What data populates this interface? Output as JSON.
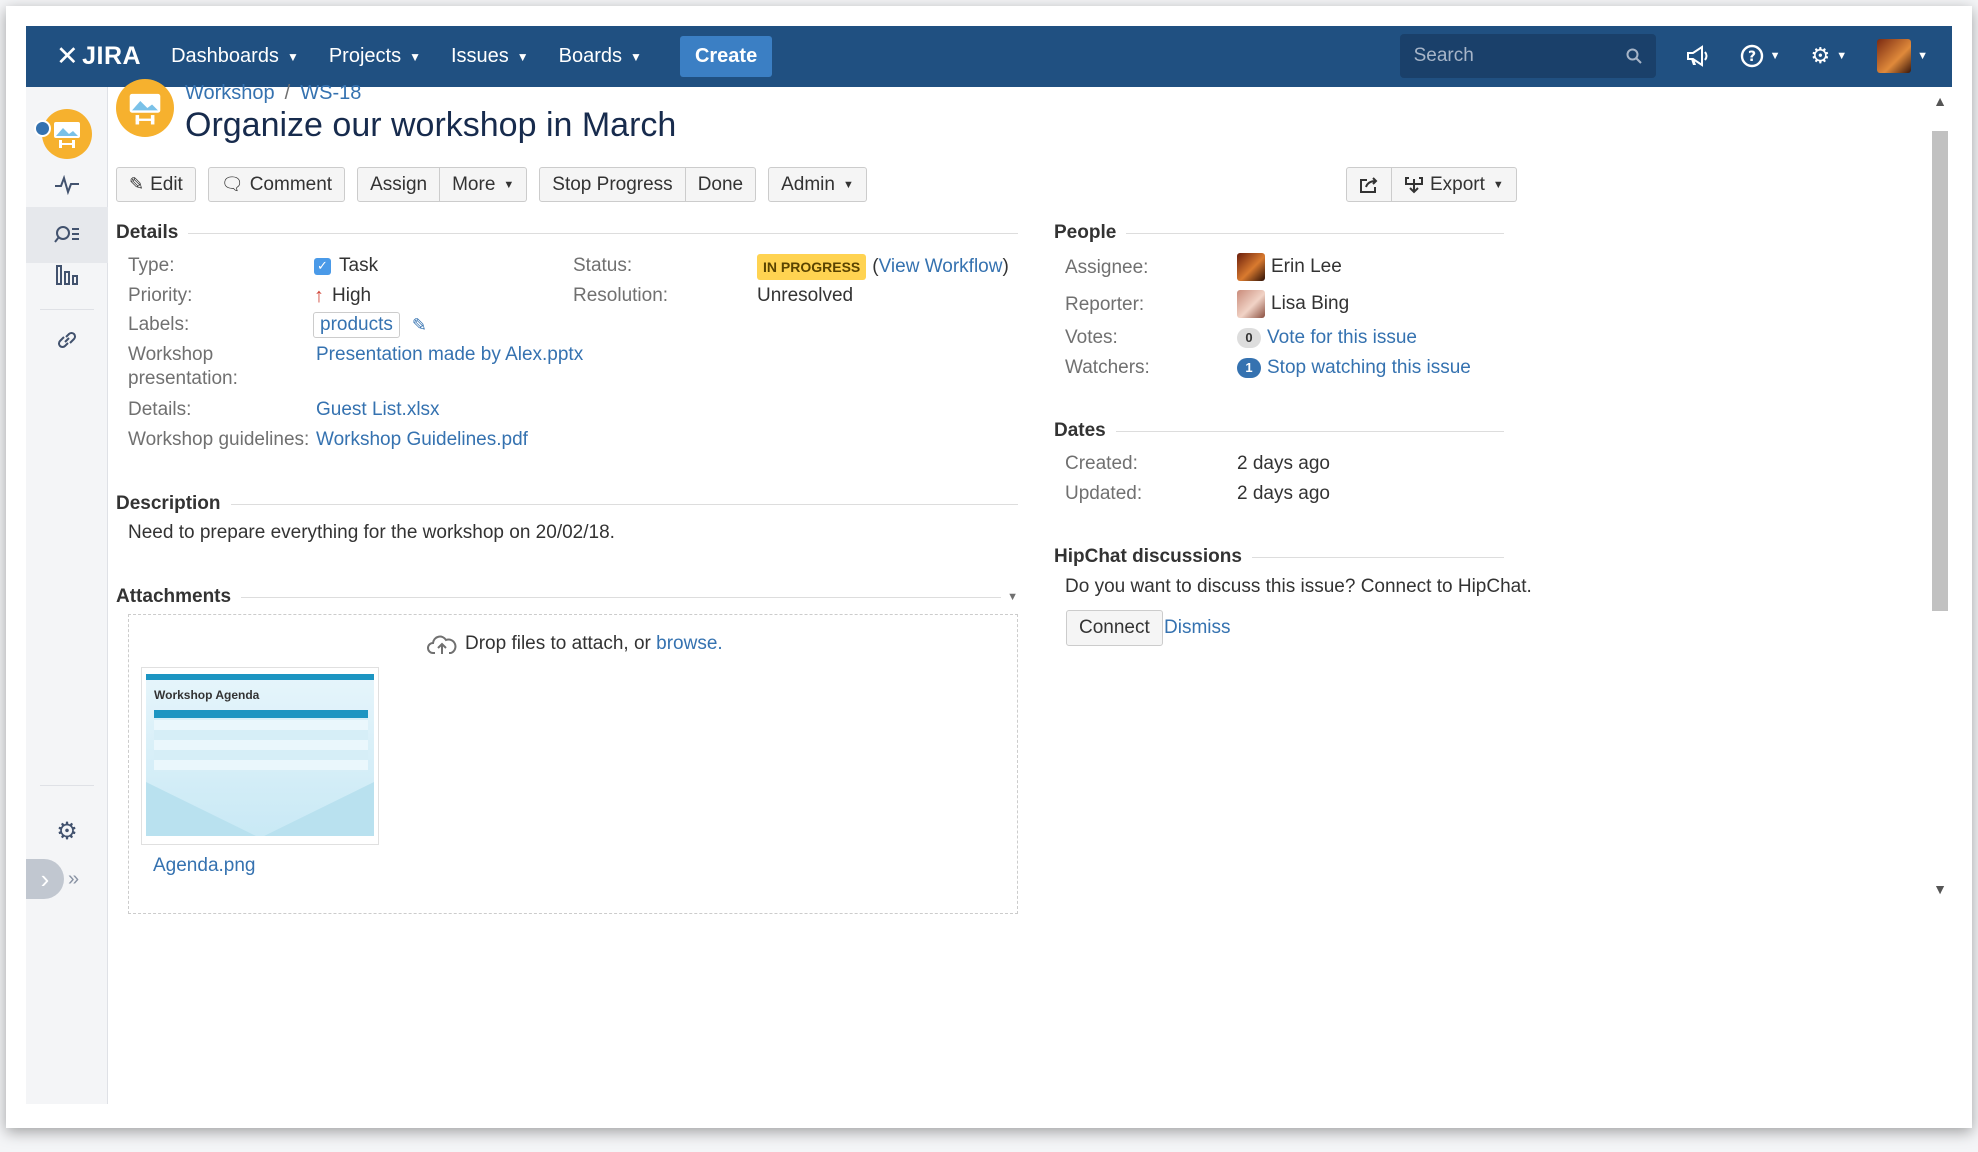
{
  "nav": {
    "logo": "JIRA",
    "items": [
      "Dashboards",
      "Projects",
      "Issues",
      "Boards"
    ],
    "create_label": "Create",
    "search_placeholder": "Search"
  },
  "breadcrumb": {
    "project": "Workshop",
    "issue_key": "WS-18"
  },
  "issue": {
    "title": "Organize our workshop in March"
  },
  "toolbar": {
    "edit": "Edit",
    "comment": "Comment",
    "assign": "Assign",
    "more": "More",
    "stop_progress": "Stop Progress",
    "done": "Done",
    "admin": "Admin",
    "export": "Export"
  },
  "details": {
    "heading": "Details",
    "type_label": "Type:",
    "type_value": "Task",
    "priority_label": "Priority:",
    "priority_value": "High",
    "labels_label": "Labels:",
    "labels_value": "products",
    "workshop_presentation_label_1": "Workshop",
    "workshop_presentation_label_2": "presentation:",
    "workshop_presentation_value": "Presentation made by Alex.pptx",
    "details_label": "Details:",
    "details_value": "Guest List.xlsx",
    "guidelines_label": "Workshop guidelines:",
    "guidelines_value": "Workshop Guidelines.pdf",
    "status_label": "Status:",
    "status_value": "IN PROGRESS",
    "view_workflow": "View Workflow",
    "resolution_label": "Resolution:",
    "resolution_value": "Unresolved"
  },
  "description": {
    "heading": "Description",
    "text": "Need to prepare everything for the workshop on 20/02/18."
  },
  "attachments": {
    "heading": "Attachments",
    "drop_text": "Drop files to attach, or",
    "browse": "browse.",
    "file_name": "Agenda.png",
    "thumb_title": "Workshop Agenda"
  },
  "people": {
    "heading": "People",
    "assignee_label": "Assignee:",
    "assignee": "Erin Lee",
    "reporter_label": "Reporter:",
    "reporter": "Lisa Bing",
    "votes_label": "Votes:",
    "votes_count": "0",
    "vote_link": "Vote for this issue",
    "watchers_label": "Watchers:",
    "watchers_count": "1",
    "watch_link": "Stop watching this issue"
  },
  "dates": {
    "heading": "Dates",
    "created_label": "Created:",
    "created": "2 days ago",
    "updated_label": "Updated:",
    "updated": "2 days ago"
  },
  "hipchat": {
    "heading": "HipChat discussions",
    "text": "Do you want to discuss this issue? Connect to HipChat.",
    "connect": "Connect",
    "dismiss": "Dismiss"
  },
  "colors": {
    "nav_bg": "#205081",
    "create_bg": "#3b7fc4",
    "link": "#3572b0",
    "status_lozenge": "#ffd351",
    "priority_high": "#d04437"
  }
}
